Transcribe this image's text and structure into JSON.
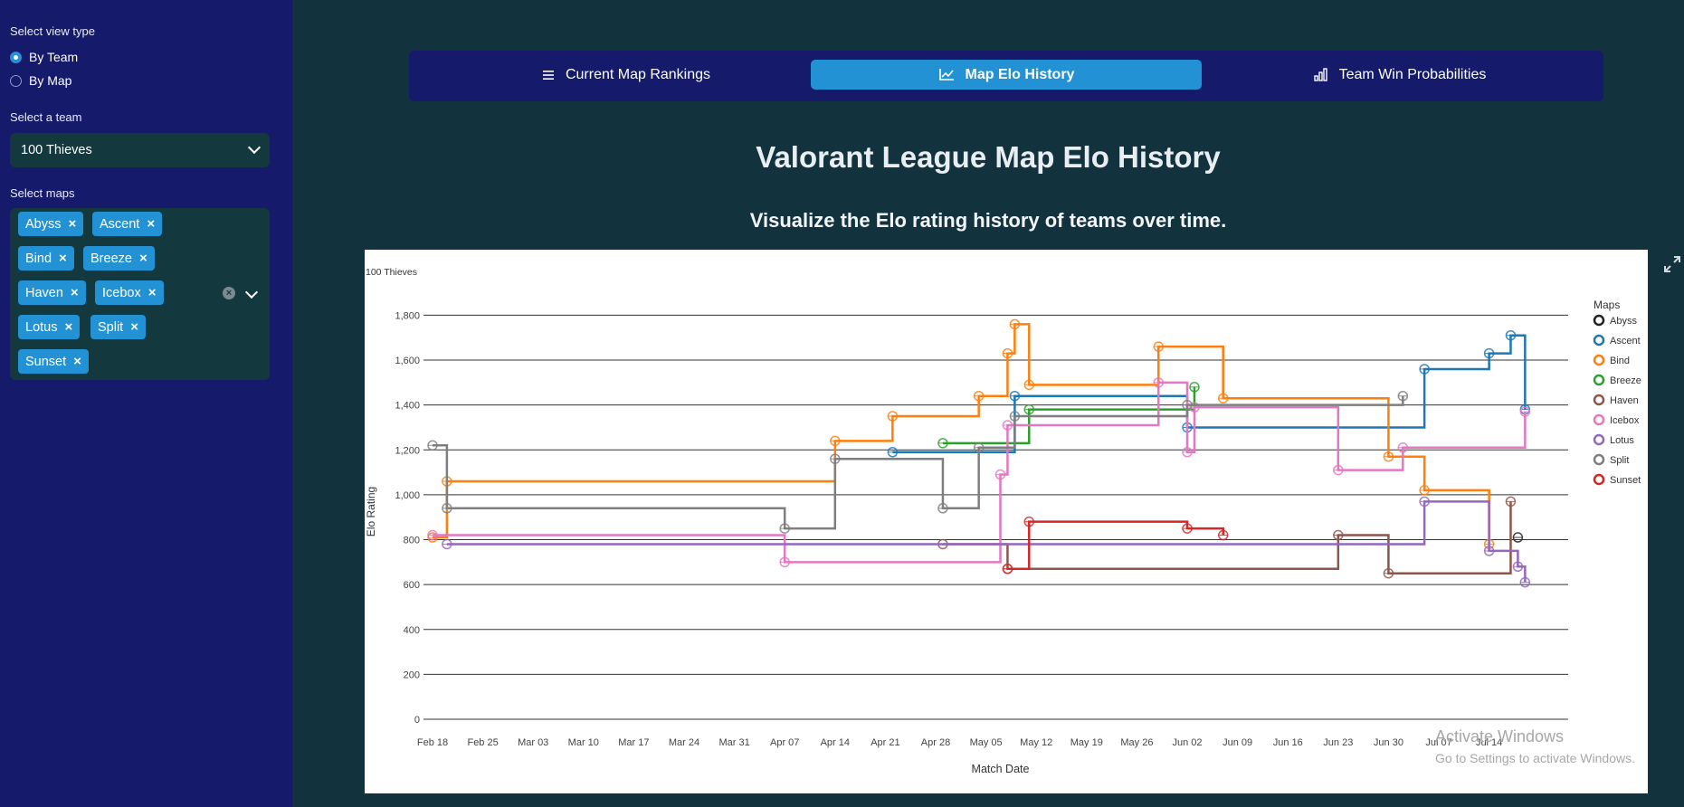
{
  "sidebar": {
    "view_type_label": "Select view type",
    "view_options": [
      {
        "label": "By Team",
        "selected": true
      },
      {
        "label": "By Map",
        "selected": false
      }
    ],
    "team_label": "Select a team",
    "team_value": "100 Thieves",
    "maps_label": "Select maps",
    "maps": [
      "Abyss",
      "Ascent",
      "Bind",
      "Breeze",
      "Haven",
      "Icebox",
      "Lotus",
      "Split",
      "Sunset"
    ]
  },
  "tabs": [
    {
      "label": "Current Map Rankings",
      "icon": "list-icon",
      "active": false
    },
    {
      "label": "Map Elo History",
      "icon": "line-chart-icon",
      "active": true
    },
    {
      "label": "Team Win Probabilities",
      "icon": "bar-chart-icon",
      "active": false
    }
  ],
  "title": "Valorant League Map Elo History",
  "subtitle": "Visualize the Elo rating history of teams over time.",
  "watermark": {
    "line1": "Activate Windows",
    "line2": "Go to Settings to activate Windows."
  },
  "chart_data": {
    "type": "line",
    "line_shape": "step",
    "title": "100 Thieves",
    "xlabel": "Match Date",
    "ylabel": "Elo Rating",
    "ylim": [
      0,
      1850
    ],
    "yticks": [
      0,
      200,
      400,
      600,
      800,
      1000,
      1200,
      1400,
      1600,
      1800
    ],
    "ytick_labels": [
      "0",
      "200",
      "400",
      "600",
      "800",
      "1,000",
      "1,200",
      "1,400",
      "1,600",
      "1,800"
    ],
    "xlim": [
      "2024-02-18",
      "2024-07-25"
    ],
    "xticks": [
      "2024-02-18",
      "2024-02-25",
      "2024-03-03",
      "2024-03-10",
      "2024-03-17",
      "2024-03-24",
      "2024-03-31",
      "2024-04-07",
      "2024-04-14",
      "2024-04-21",
      "2024-04-28",
      "2024-05-05",
      "2024-05-12",
      "2024-05-19",
      "2024-05-26",
      "2024-06-02",
      "2024-06-09",
      "2024-06-16",
      "2024-06-23",
      "2024-06-30",
      "2024-07-07",
      "2024-07-14"
    ],
    "xtick_labels": [
      "Feb 18",
      "Feb 25",
      "Mar 03",
      "Mar 10",
      "Mar 17",
      "Mar 24",
      "Mar 31",
      "Apr 07",
      "Apr 14",
      "Apr 21",
      "Apr 28",
      "May 05",
      "May 12",
      "May 19",
      "May 26",
      "Jun 02",
      "Jun 09",
      "Jun 16",
      "Jun 23",
      "Jun 30",
      "Jul 07",
      "Jul 14"
    ],
    "legend_title": "Maps",
    "legend_position": "right",
    "grid": true,
    "series": [
      {
        "name": "Abyss",
        "color": "#222222",
        "points": [
          [
            "2024-07-18",
            810
          ]
        ]
      },
      {
        "name": "Ascent",
        "color": "#1f77b4",
        "points": [
          [
            "2024-04-22",
            1190
          ],
          [
            "2024-05-09",
            1440
          ],
          [
            "2024-06-02",
            1300
          ],
          [
            "2024-07-05",
            1560
          ],
          [
            "2024-07-14",
            1630
          ],
          [
            "2024-07-17",
            1710
          ],
          [
            "2024-07-19",
            1380
          ]
        ]
      },
      {
        "name": "Bind",
        "color": "#ff7f0e",
        "points": [
          [
            "2024-02-18",
            810
          ],
          [
            "2024-02-20",
            1060
          ],
          [
            "2024-04-14",
            1240
          ],
          [
            "2024-04-22",
            1350
          ],
          [
            "2024-05-04",
            1440
          ],
          [
            "2024-05-08",
            1630
          ],
          [
            "2024-05-09",
            1760
          ],
          [
            "2024-05-11",
            1490
          ],
          [
            "2024-05-29",
            1660
          ],
          [
            "2024-06-07",
            1430
          ],
          [
            "2024-06-30",
            1170
          ],
          [
            "2024-07-05",
            1020
          ],
          [
            "2024-07-14",
            780
          ]
        ]
      },
      {
        "name": "Breeze",
        "color": "#2ca02c",
        "points": [
          [
            "2024-04-29",
            1230
          ],
          [
            "2024-05-11",
            1380
          ],
          [
            "2024-06-03",
            1480
          ]
        ]
      },
      {
        "name": "Haven",
        "color": "#8c564b",
        "points": [
          [
            "2024-04-29",
            780
          ],
          [
            "2024-05-08",
            670
          ],
          [
            "2024-06-23",
            820
          ],
          [
            "2024-06-30",
            650
          ],
          [
            "2024-07-17",
            970
          ]
        ]
      },
      {
        "name": "Icebox",
        "color": "#e377c2",
        "points": [
          [
            "2024-02-18",
            820
          ],
          [
            "2024-04-07",
            700
          ],
          [
            "2024-05-07",
            1090
          ],
          [
            "2024-05-08",
            1310
          ],
          [
            "2024-05-29",
            1500
          ],
          [
            "2024-06-02",
            1190
          ],
          [
            "2024-06-03",
            1390
          ],
          [
            "2024-06-23",
            1110
          ],
          [
            "2024-07-02",
            1210
          ],
          [
            "2024-07-19",
            1370
          ]
        ]
      },
      {
        "name": "Lotus",
        "color": "#9467bd",
        "points": [
          [
            "2024-02-20",
            780
          ],
          [
            "2024-07-05",
            970
          ],
          [
            "2024-07-14",
            750
          ],
          [
            "2024-07-18",
            680
          ],
          [
            "2024-07-19",
            610
          ]
        ]
      },
      {
        "name": "Split",
        "color": "#7f7f7f",
        "points": [
          [
            "2024-02-18",
            1220
          ],
          [
            "2024-02-20",
            940
          ],
          [
            "2024-04-07",
            850
          ],
          [
            "2024-04-14",
            1160
          ],
          [
            "2024-04-29",
            940
          ],
          [
            "2024-05-04",
            1210
          ],
          [
            "2024-05-09",
            1350
          ],
          [
            "2024-06-02",
            1400
          ],
          [
            "2024-07-02",
            1440
          ]
        ]
      },
      {
        "name": "Sunset",
        "color": "#d62728",
        "points": [
          [
            "2024-05-08",
            670
          ],
          [
            "2024-05-11",
            880
          ],
          [
            "2024-06-02",
            850
          ],
          [
            "2024-06-07",
            820
          ]
        ]
      }
    ]
  }
}
